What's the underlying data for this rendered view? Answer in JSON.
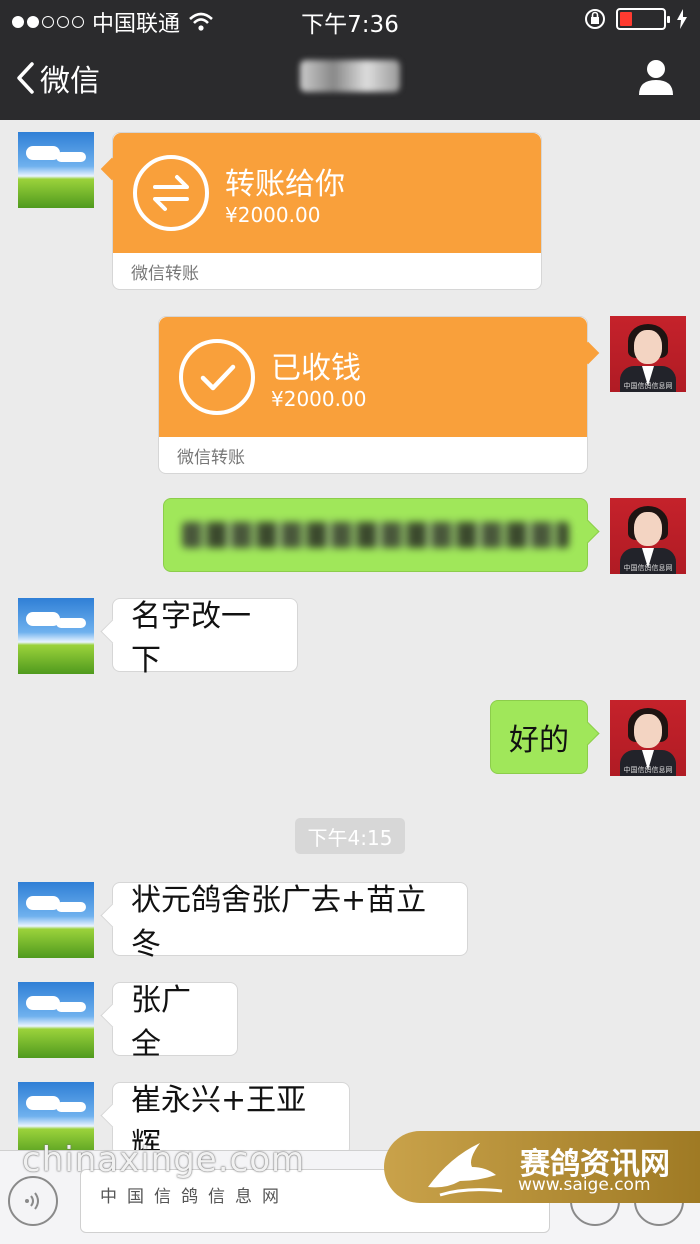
{
  "status_bar": {
    "carrier": "中国联通",
    "time": "下午7:36"
  },
  "nav": {
    "back_label": "微信",
    "title_obscured": true
  },
  "messages": [
    {
      "type": "transfer",
      "side": "left",
      "title": "转账给你",
      "amount": "¥2000.00",
      "footer": "微信转账",
      "icon": "transfer-arrows-icon"
    },
    {
      "type": "transfer",
      "side": "right",
      "title": "已收钱",
      "amount": "¥2000.00",
      "footer": "微信转账",
      "icon": "checkmark-icon"
    },
    {
      "type": "text",
      "side": "right",
      "text_obscured": true
    },
    {
      "type": "text",
      "side": "left",
      "text": "名字改一下"
    },
    {
      "type": "text",
      "side": "right",
      "text": "好的"
    },
    {
      "type": "timestamp",
      "text": "下午4:15"
    },
    {
      "type": "text",
      "side": "left",
      "text": "状元鸽舍张广去+苗立冬"
    },
    {
      "type": "text",
      "side": "left",
      "text": "张广全"
    },
    {
      "type": "text",
      "side": "left",
      "text": "崔永兴+王亚辉"
    }
  ],
  "avatar_caption": "中国信鸽信息网",
  "watermark": {
    "site_en": "chinaxinge.com",
    "site_cn": "中国信鸽信息网",
    "brand": "赛鸽资讯网",
    "url": "www.saige.com"
  },
  "colors": {
    "header_bg": "#2b2b2d",
    "chat_bg": "#ebebeb",
    "transfer_orange": "#f9a03b",
    "sent_green": "#a0e75a"
  }
}
